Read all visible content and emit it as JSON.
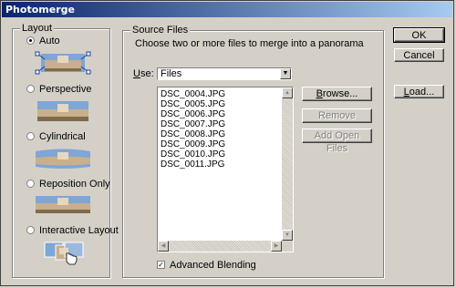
{
  "window": {
    "title": "Photomerge"
  },
  "layout": {
    "legend": "Layout",
    "options": [
      {
        "label": "Auto",
        "selected": true
      },
      {
        "label": "Perspective",
        "selected": false
      },
      {
        "label": "Cylindrical",
        "selected": false
      },
      {
        "label": "Reposition Only",
        "selected": false
      },
      {
        "label": "Interactive Layout",
        "selected": false
      }
    ]
  },
  "source": {
    "legend": "Source Files",
    "instruction": "Choose two or more files to merge into a panorama",
    "use_label": "Use:",
    "use_value": "Files",
    "files": [
      "DSC_0004.JPG",
      "DSC_0005.JPG",
      "DSC_0006.JPG",
      "DSC_0007.JPG",
      "DSC_0008.JPG",
      "DSC_0009.JPG",
      "DSC_0010.JPG",
      "DSC_0011.JPG"
    ],
    "browse_label": "Browse...",
    "remove_label": "Remove",
    "add_open_label": "Add Open Files",
    "advanced_label": "Advanced Blending",
    "advanced_checked": true
  },
  "buttons": {
    "ok": "OK",
    "cancel": "Cancel",
    "load": "Load..."
  },
  "icons": {
    "radio": "radio-icon",
    "dropdown": "chevron-down-icon",
    "checkmark": "checkmark-icon",
    "hand": "hand-cursor-icon"
  },
  "colors": {
    "dialog": "#d4d0c8",
    "title_start": "#0a246a",
    "title_end": "#a6caf0"
  }
}
